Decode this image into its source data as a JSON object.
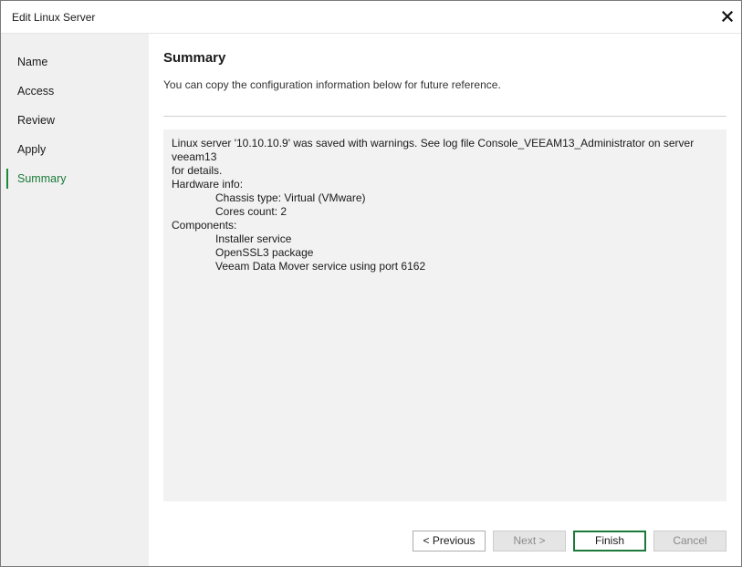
{
  "window": {
    "title": "Edit Linux Server"
  },
  "sidebar": {
    "steps": [
      {
        "label": "Name"
      },
      {
        "label": "Access"
      },
      {
        "label": "Review"
      },
      {
        "label": "Apply"
      },
      {
        "label": "Summary"
      }
    ],
    "active_step": "Summary",
    "accent_color": "#1a8a3a"
  },
  "main": {
    "heading": "Summary",
    "subheading": "You can copy the configuration information below for future reference.",
    "summary": {
      "line1": "Linux server '10.10.10.9' was saved with warnings. See log file Console_VEEAM13_Administrator on server veeam13",
      "line2": "for details.",
      "hardware_header": "Hardware info:",
      "chassis": "Chassis type: Virtual (VMware)",
      "cores": "Cores count: 2",
      "components_header": "Components:",
      "component1": "Installer service",
      "component2": "OpenSSL3 package",
      "component3": "Veeam Data Mover service using port 6162"
    }
  },
  "buttons": {
    "previous": "< Previous",
    "next": "Next >",
    "finish": "Finish",
    "cancel": "Cancel"
  },
  "icons": {
    "close": "close-icon"
  }
}
